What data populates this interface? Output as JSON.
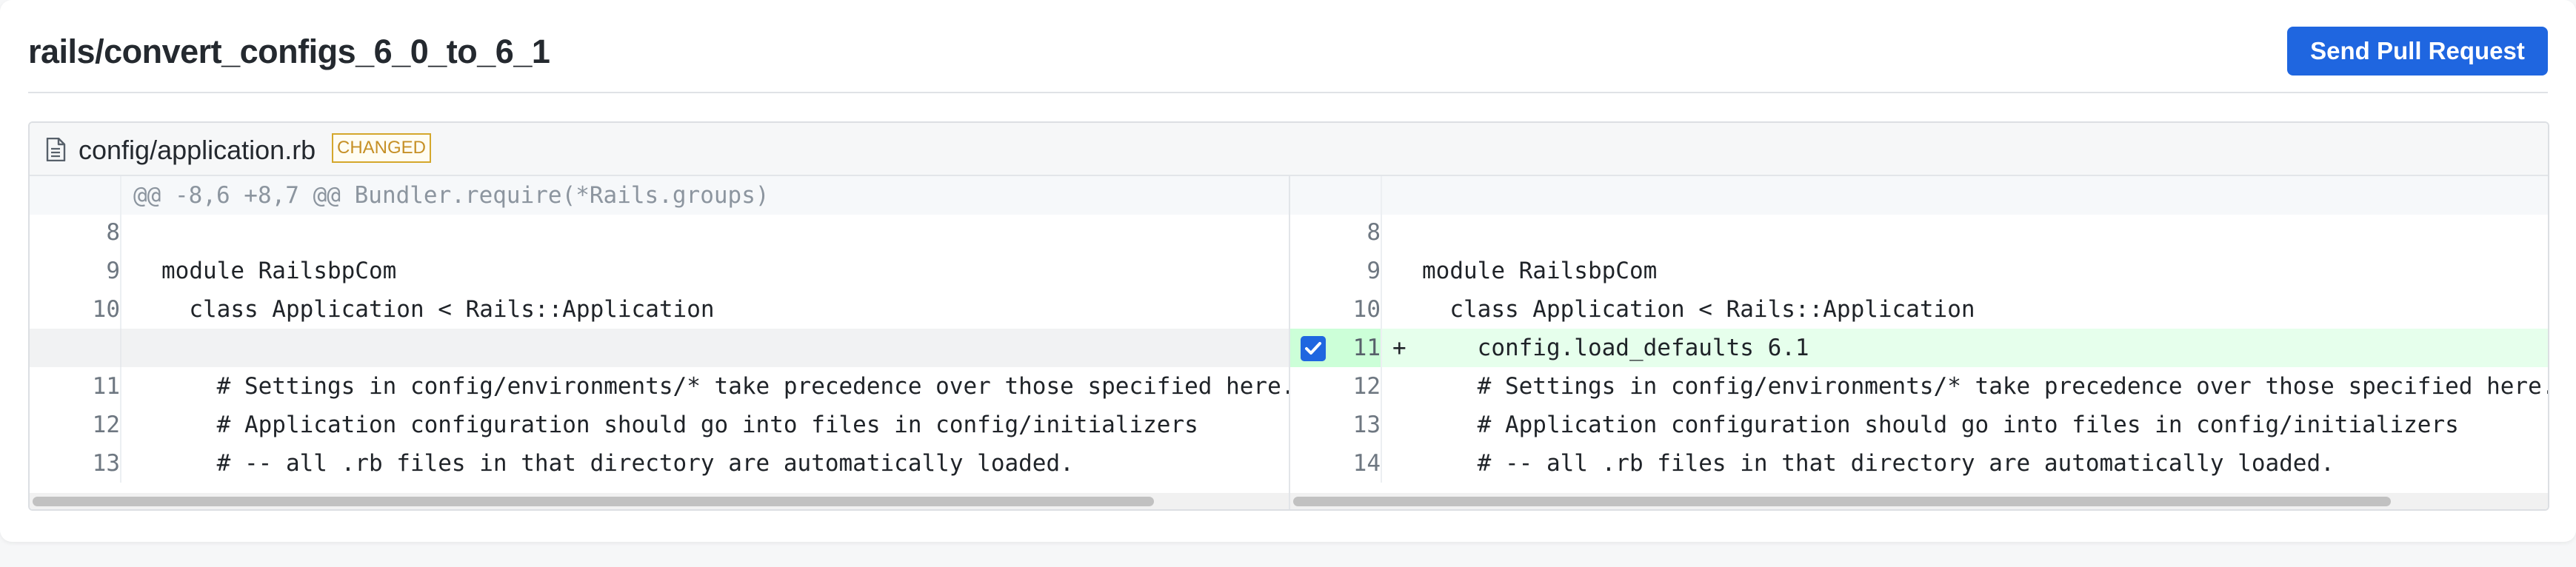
{
  "header": {
    "title": "rails/convert_configs_6_0_to_6_1",
    "send_button": "Send Pull Request"
  },
  "file": {
    "name": "config/application.rb",
    "badge": "CHANGED",
    "icon": "file-icon"
  },
  "hunk": "@@ -8,6 +8,7 @@ Bundler.require(*Rails.groups)",
  "left_lines": [
    {
      "num": "8",
      "code": ""
    },
    {
      "num": "9",
      "code": "module RailsbpCom"
    },
    {
      "num": "10",
      "code": "  class Application < Rails::Application"
    },
    {
      "num": "",
      "code": ""
    },
    {
      "num": "11",
      "code": "    # Settings in config/environments/* take precedence over those specified here."
    },
    {
      "num": "12",
      "code": "    # Application configuration should go into files in config/initializers"
    },
    {
      "num": "13",
      "code": "    # -- all .rb files in that directory are automatically loaded."
    }
  ],
  "right_lines": [
    {
      "num": "8",
      "code": "",
      "marker": ""
    },
    {
      "num": "9",
      "code": "module RailsbpCom",
      "marker": ""
    },
    {
      "num": "10",
      "code": "  class Application < Rails::Application",
      "marker": ""
    },
    {
      "num": "11",
      "code": "    config.load_defaults 6.1",
      "marker": "+"
    },
    {
      "num": "12",
      "code": "    # Settings in config/environments/* take precedence over those specified here.",
      "marker": ""
    },
    {
      "num": "13",
      "code": "    # Application configuration should go into files in config/initializers",
      "marker": ""
    },
    {
      "num": "14",
      "code": "    # -- all .rb files in that directory are automatically loaded.",
      "marker": ""
    }
  ],
  "colors": {
    "accent": "#1f66e0",
    "added_bg": "#e6ffec",
    "badge": "#d4a72c"
  }
}
